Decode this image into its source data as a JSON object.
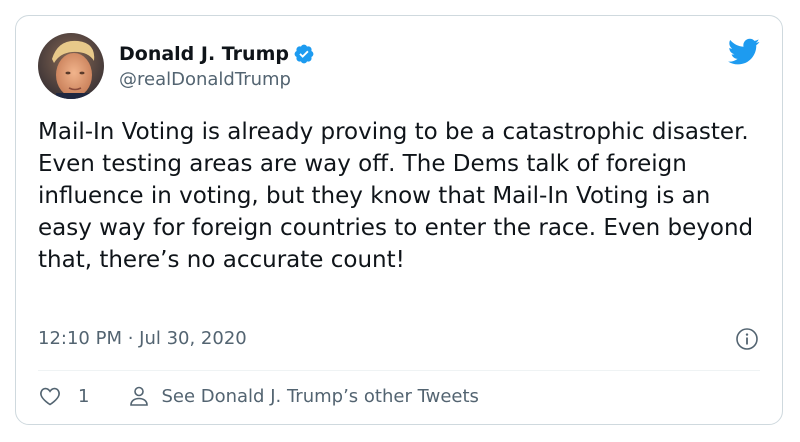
{
  "author": {
    "display_name": "Donald J. Trump",
    "handle": "@realDonaldTrump",
    "verified": true
  },
  "tweet": {
    "text": "Mail-In Voting is already proving to be a catastrophic disaster. Even testing areas are way off. The Dems talk of foreign influence in voting, but they know that Mail-In Voting is an easy way for foreign countries to enter the race. Even beyond that, there’s no accurate count!",
    "timestamp": "12:10 PM · Jul 30, 2020"
  },
  "actions": {
    "like_count": "1",
    "other_tweets_label": "See Donald J. Trump’s other Tweets"
  },
  "icons": {
    "verified": "verified-badge-icon",
    "logo": "twitter-bird-icon",
    "info": "info-icon",
    "like": "heart-icon",
    "user": "user-icon"
  },
  "colors": {
    "brand_blue": "#1d9bf0",
    "text_primary": "#0f1419",
    "text_secondary": "#536471",
    "border": "#cfd9de"
  }
}
